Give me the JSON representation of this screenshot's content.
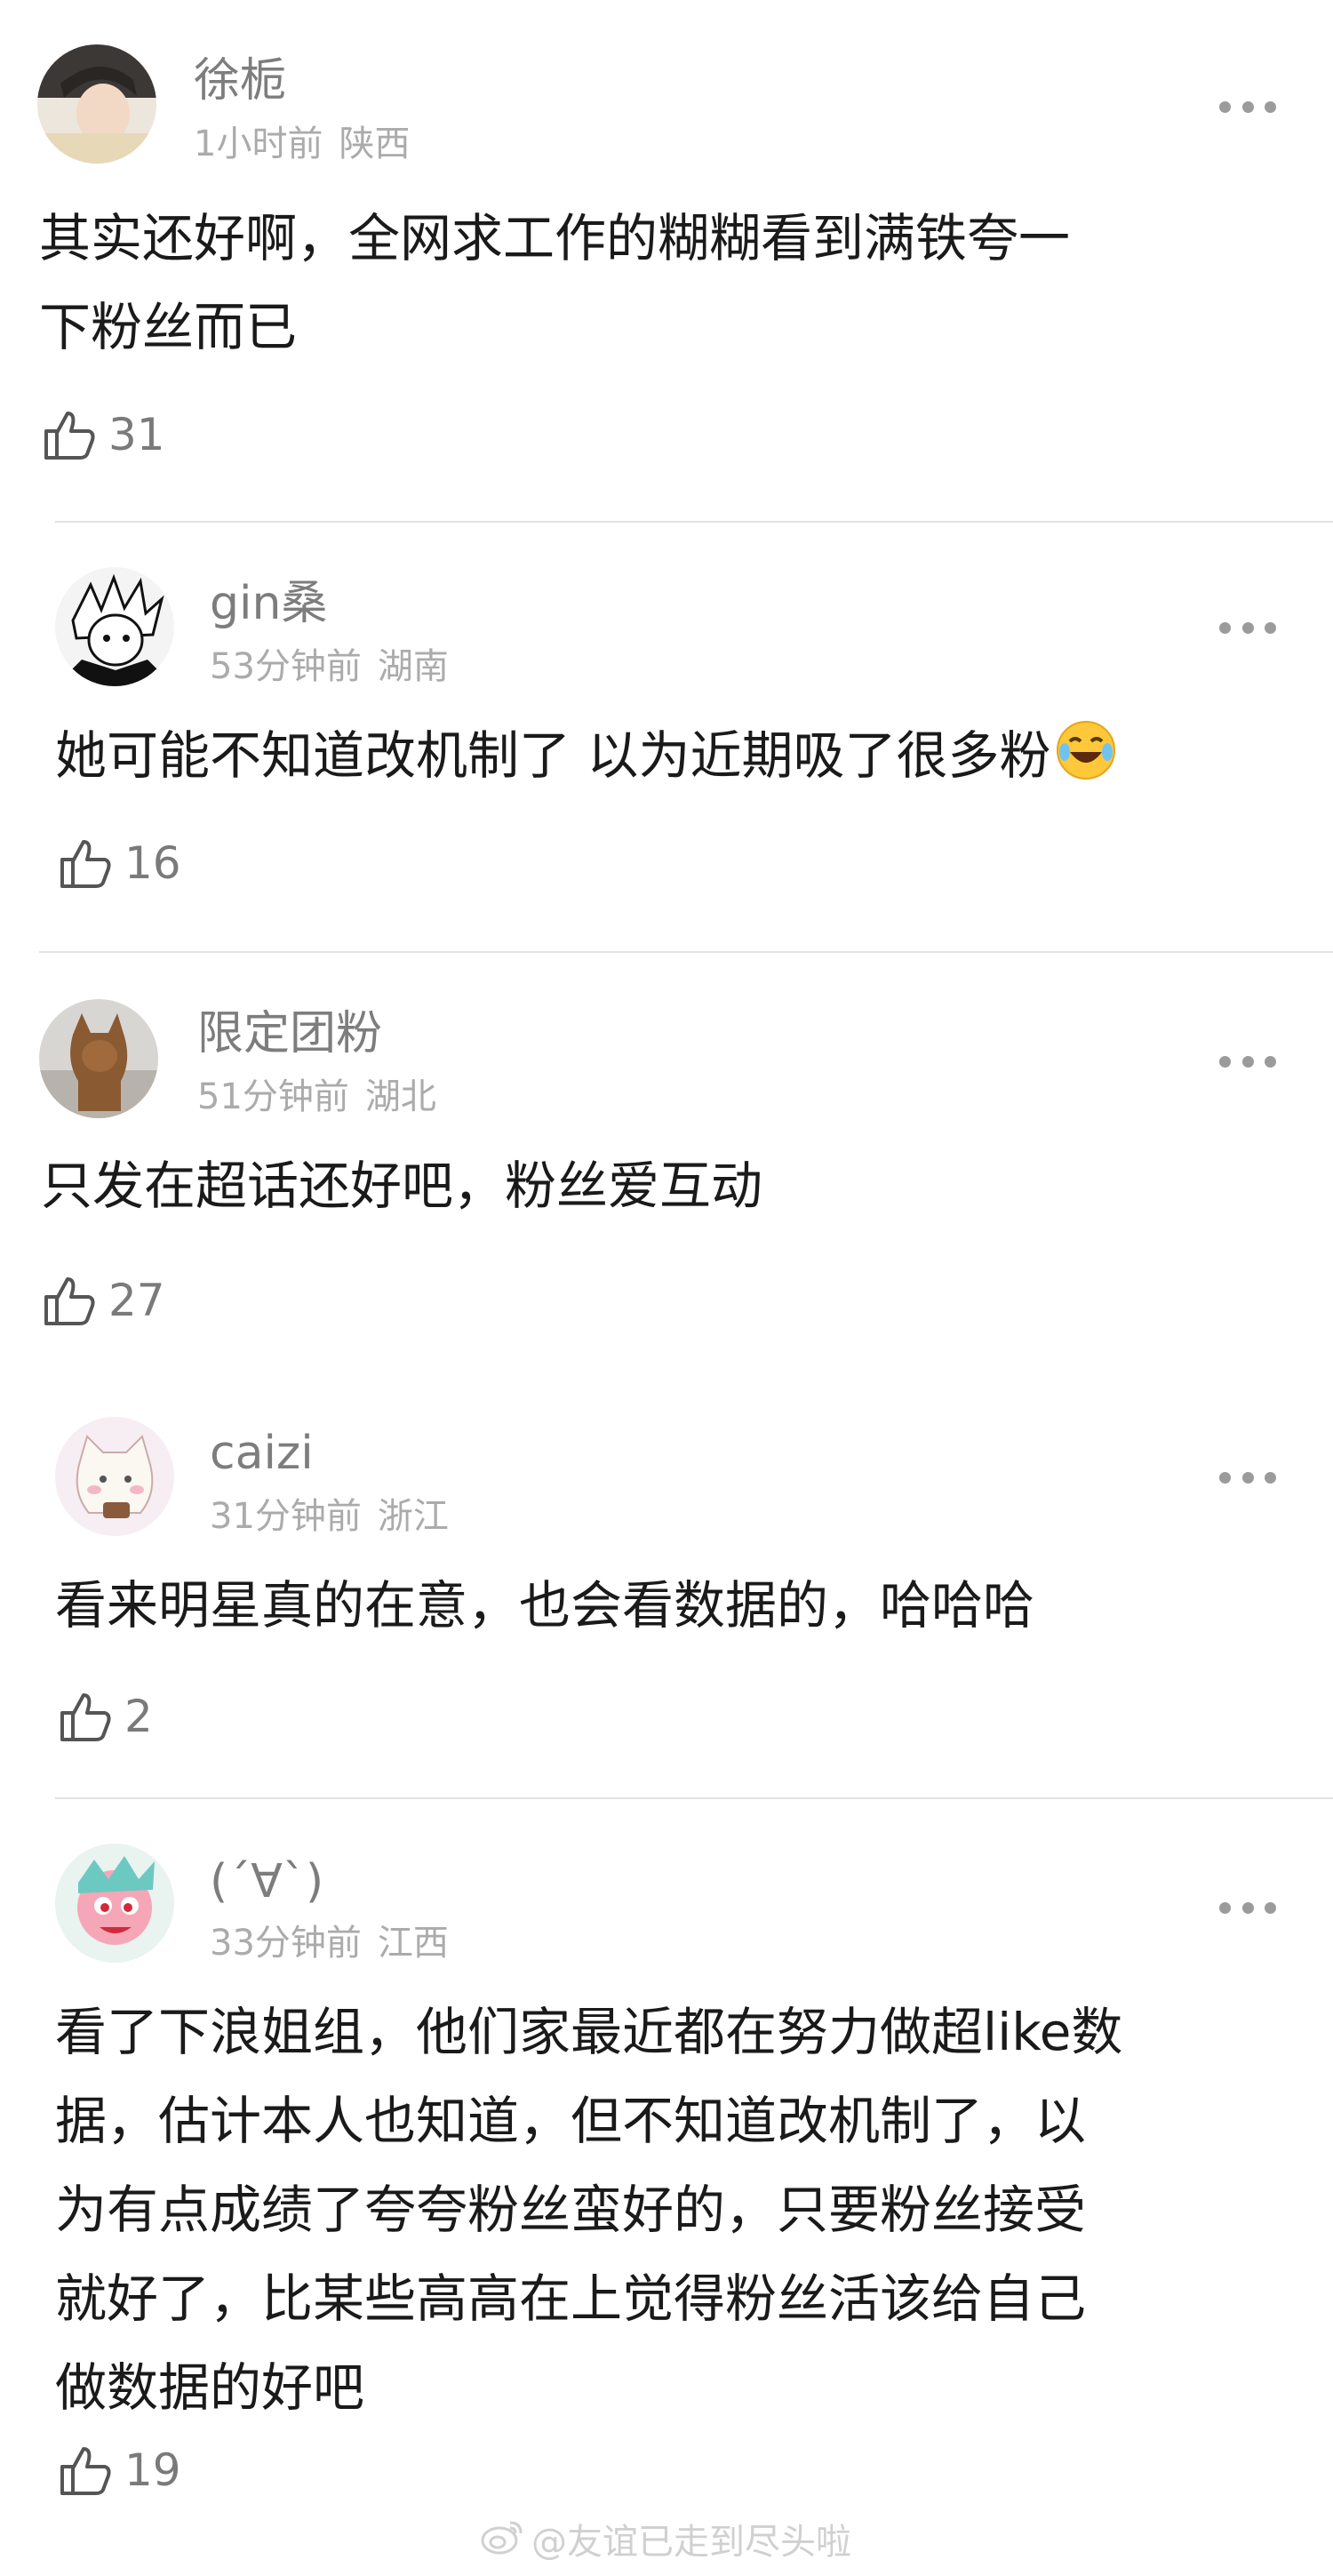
{
  "comments": [
    {
      "username": "徐栀",
      "time": "1小时前",
      "location": "陕西",
      "content_lines": [
        "其实还好啊，全网求工作的糊糊看到满铁夸一",
        "下粉丝而已"
      ],
      "likes": "31"
    },
    {
      "username": "gin桑",
      "time": "53分钟前",
      "location": "湖南",
      "content_lines": [
        "她可能不知道改机制了 以为近期吸了很多粉"
      ],
      "emoji": "laughing-crying-emoji",
      "likes": "16"
    },
    {
      "username": "限定团粉",
      "time": "51分钟前",
      "location": "湖北",
      "content_lines": [
        "只发在超话还好吧，粉丝爱互动"
      ],
      "likes": "27"
    },
    {
      "username": "caizi",
      "time": "31分钟前",
      "location": "浙江",
      "content_lines": [
        "看来明星真的在意，也会看数据的，哈哈哈"
      ],
      "likes": "2"
    },
    {
      "username": "(´∀`)",
      "time": "33分钟前",
      "location": "江西",
      "content_lines": [
        "看了下浪姐组，他们家最近都在努力做超like数",
        "据，估计本人也知道，但不知道改机制了，以",
        "为有点成绩了夸夸粉丝蛮好的，只要粉丝接受",
        "就好了，比某些高高在上觉得粉丝活该给自己",
        "做数据的好吧"
      ],
      "likes": "19"
    }
  ],
  "watermark": "@友谊已走到尽头啦",
  "icons": {
    "like": "thumbs-up-icon",
    "more": "more-dots-icon",
    "watermark": "weibo-logo-icon"
  },
  "colors": {
    "username": "#7d7d7d",
    "meta": "#ababab",
    "content": "#1a1a1a",
    "divider": "#e3e3e3"
  }
}
